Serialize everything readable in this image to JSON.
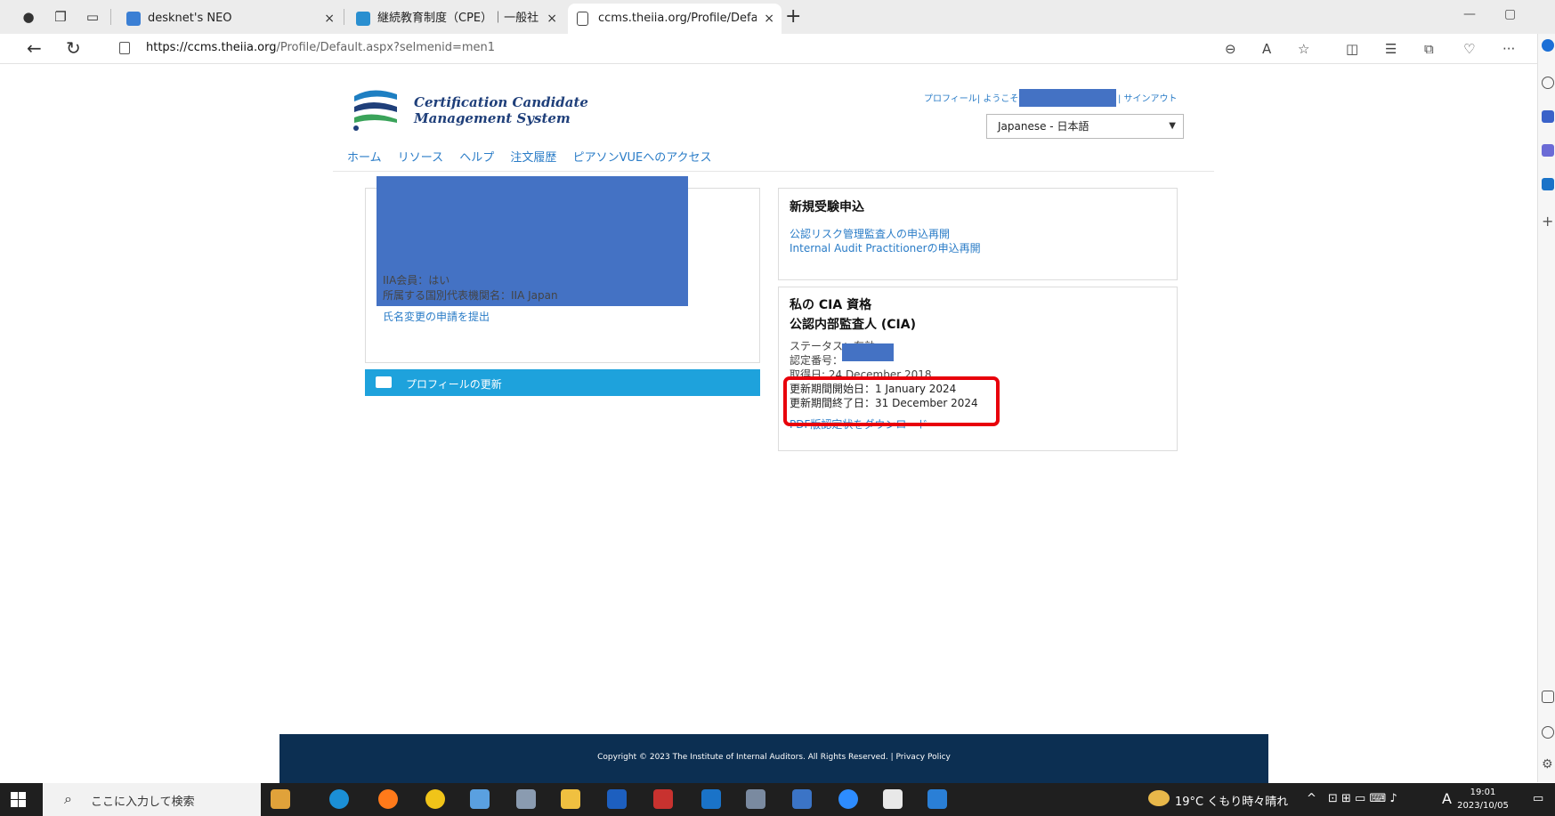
{
  "browser": {
    "tabs": [
      {
        "title": "desknet's NEO",
        "close": "×"
      },
      {
        "title": "継続教育制度（CPE）｜一般社団",
        "close": "×"
      },
      {
        "title": "ccms.theiia.org/Profile/Default.a",
        "close": "×"
      }
    ],
    "new_tab": "+",
    "window_controls": {
      "minimize": "—",
      "maximize": "▢"
    },
    "url_host": "https://ccms.theiia.org",
    "url_path": "/Profile/Default.aspx?selmenid=men1",
    "more": "···"
  },
  "header": {
    "brand_line1": "Certification Candidate",
    "brand_line2": "Management System",
    "profile_welcome": "プロフィール| ようこそ",
    "signout": "| サインアウト",
    "language": "Japanese - 日本語"
  },
  "nav": {
    "items": [
      "ホーム",
      "リソース",
      "ヘルプ",
      "注文履歴",
      "ピアソンVUEへのアクセス"
    ]
  },
  "profile": {
    "member": "IIA会員：はい",
    "institute": "所属する国別代表機関名：IIA Japan",
    "name_change_link": "氏名変更の申請を提出",
    "update_button": "プロフィールの更新"
  },
  "new_exam": {
    "heading": "新規受験申込",
    "links": [
      "公認リスク管理監査人の申込再開",
      "Internal Audit Practitionerの申込再開"
    ]
  },
  "cia": {
    "heading": "私の CIA 資格",
    "designation": "公認内部監査人 (CIA)",
    "status": "ステータス：有効",
    "cert_number_label": "認定番号：",
    "acquired": "取得日: 24 December 2018",
    "renew_start": "更新期間開始日：1 January 2024",
    "renew_end": "更新期間終了日：31 December 2024",
    "pdf_link": "PDF版認定状をダウンロード"
  },
  "footer": {
    "text": "Copyright © 2023 The Institute of Internal Auditors. All Rights Reserved. | Privacy Policy"
  },
  "taskbar": {
    "search_placeholder": "ここに入力して検索",
    "weather": "19°C くもり時々晴れ",
    "time": "19:01",
    "date": "2023/10/05"
  },
  "colors": {
    "brand_navy": "#1f3f7a",
    "link_blue": "#2a7cc7",
    "update_bar": "#1ea2dc",
    "footer": "#0c2f52",
    "redaction": "#4472c4",
    "highlight_red": "#e8000b"
  }
}
